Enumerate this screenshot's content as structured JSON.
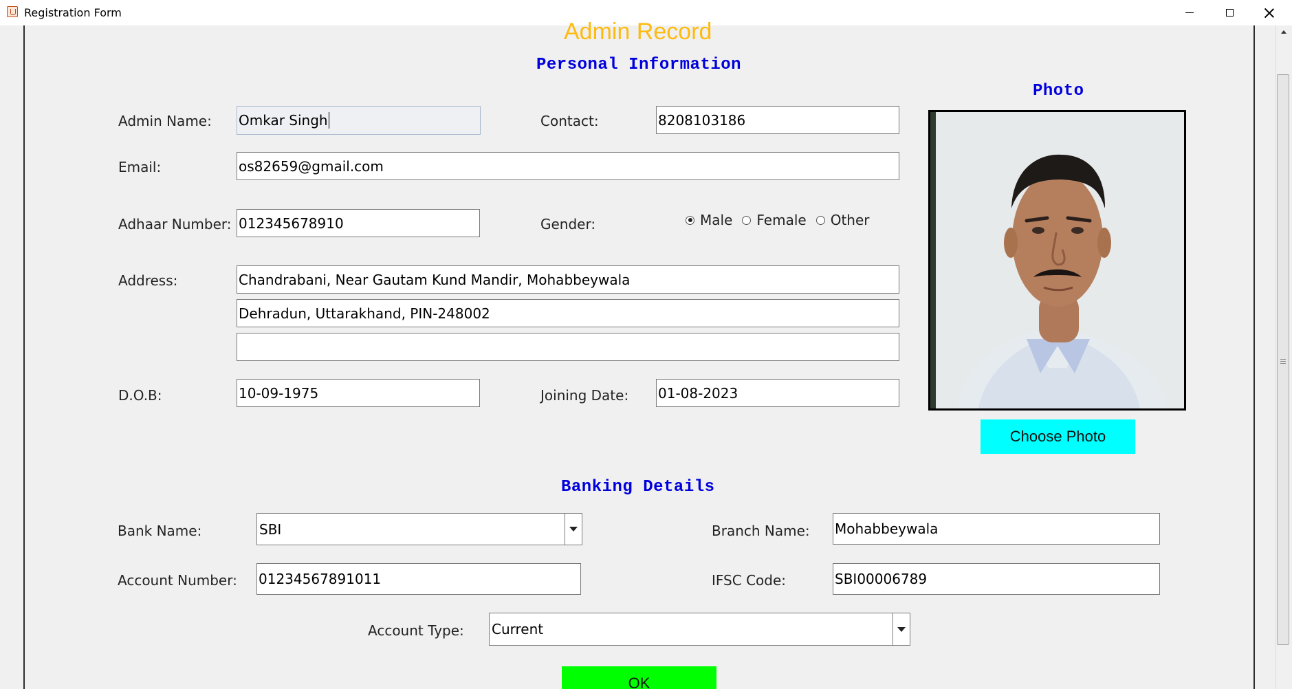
{
  "window": {
    "title": "Registration Form"
  },
  "page": {
    "title": "Admin Record",
    "personal_heading": "Personal Information",
    "photo_heading": "Photo",
    "banking_heading": "Banking Details"
  },
  "personal": {
    "admin_name_label": "Admin Name:",
    "admin_name_value": "Omkar Singh",
    "contact_label": "Contact:",
    "contact_value": "8208103186",
    "email_label": "Email:",
    "email_value": "os82659@gmail.com",
    "adhaar_label": "Adhaar Number:",
    "adhaar_value": "012345678910",
    "gender_label": "Gender:",
    "gender_options": [
      "Male",
      "Female",
      "Other"
    ],
    "gender_selected": "Male",
    "address_label": "Address:",
    "address_line1": "Chandrabani, Near Gautam Kund Mandir, Mohabbeywala",
    "address_line2": "Dehradun, Uttarakhand, PIN-248002",
    "address_line3": "",
    "dob_label": "D.O.B:",
    "dob_value": "10-09-1975",
    "joining_label": "Joining Date:",
    "joining_value": "01-08-2023"
  },
  "photo": {
    "choose_label": "Choose Photo"
  },
  "banking": {
    "bank_name_label": "Bank Name:",
    "bank_name_value": "SBI",
    "branch_label": "Branch Name:",
    "branch_value": "Mohabbeywala",
    "account_number_label": "Account Number:",
    "account_number_value": "01234567891011",
    "ifsc_label": "IFSC Code:",
    "ifsc_value": "SBI00006789",
    "account_type_label": "Account Type:",
    "account_type_value": "Current"
  },
  "ok_label": "OK",
  "colors": {
    "title": "#fdbb12",
    "heading": "#0000dd",
    "choose_photo_button": "#00ffff",
    "ok_button": "#00ff00"
  }
}
